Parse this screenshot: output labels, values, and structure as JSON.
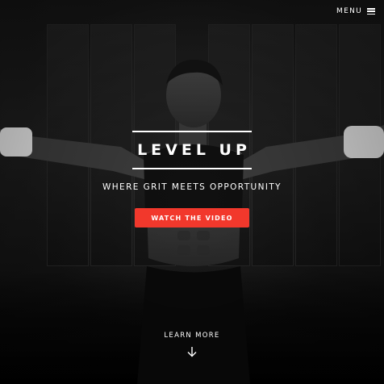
{
  "header": {
    "menu_label": "MENU",
    "menu_icon": "hamburger-icon"
  },
  "hero": {
    "title": "LEVEL UP",
    "subtitle": "WHERE GRIT MEETS OPPORTUNITY",
    "cta_label": "WATCH THE VIDEO",
    "learn_more_label": "LEARN MORE",
    "learn_more_icon": "arrow-down-icon"
  },
  "colors": {
    "accent": "#f2382c",
    "text": "#ffffff",
    "background": "#1a1a1a"
  }
}
